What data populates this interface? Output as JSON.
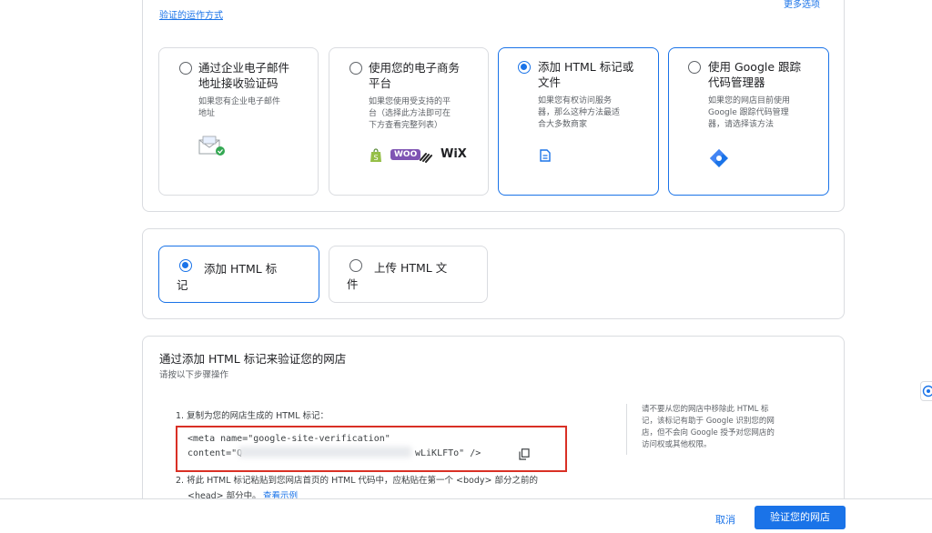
{
  "header": {
    "how_it_works_link": "验证的运作方式",
    "more_options_link": "更多选项"
  },
  "methods": [
    {
      "title_line1": "通过企业电子邮件",
      "title_line2": "地址接收验证码",
      "desc_line1": "如果您有企业电子邮件",
      "desc_line2": "地址",
      "desc_line3": "",
      "selected": false,
      "icon": "email-icon"
    },
    {
      "title_line1": "使用您的电子商务",
      "title_line2": "平台",
      "desc_line1": "如果您使用受支持的平",
      "desc_line2": "台（选择此方法即可在",
      "desc_line3": "下方查看完整列表）",
      "selected": false,
      "icon": "ecommerce-logos",
      "logo_woo": "WOO",
      "logo_wix": "WiX"
    },
    {
      "title_line1": "添加 HTML 标记或",
      "title_line2": "文件",
      "desc_line1": "如果您有权访问服务",
      "desc_line2": "器，那么这种方法最适",
      "desc_line3": "合大多数商家",
      "selected": true,
      "icon": "document-icon"
    },
    {
      "title_line1": "使用 Google 跟踪",
      "title_line2": "代码管理器",
      "desc_line1": "如果您的网店目前使用",
      "desc_line2": "Google 跟踪代码管理",
      "desc_line3": "器，请选择该方法",
      "selected": false,
      "icon": "tag-manager-icon"
    }
  ],
  "sub_options": [
    {
      "label_line1": "添加 HTML 标",
      "label_line2": "记",
      "selected": true
    },
    {
      "label_line1": "上传 HTML 文",
      "label_line2": "件",
      "selected": false
    }
  ],
  "instructions": {
    "title": "通过添加 HTML 标记来验证您的网店",
    "subtitle": "请按以下步骤操作",
    "step1": "1. 复制为您的网店生成的 HTML 标记：",
    "code_line1": "<meta name=\"google-site-verification\"",
    "code_line2_start": "content=\"Q",
    "code_line2_end": "wLiKLFTo\" />",
    "step2_line1": "2. 将此 HTML 标记粘贴到您网店首页的 HTML 代码中，应粘贴在第一个 <body> 部分之前的",
    "step2_line2": "<head> 部分中。",
    "example_link": "查看示例",
    "side_note_line1": "请不要从您的网店中移除此 HTML 标",
    "side_note_line2": "记，该标记有助于 Google 识别您的网",
    "side_note_line3": "店，但不会向 Google 授予对您网店的",
    "side_note_line4": "访问权或其他权限。"
  },
  "footer": {
    "cancel": "取消",
    "verify": "验证您的网店"
  },
  "colors": {
    "accent": "#1a73e8",
    "highlight_box": "#d93025"
  }
}
